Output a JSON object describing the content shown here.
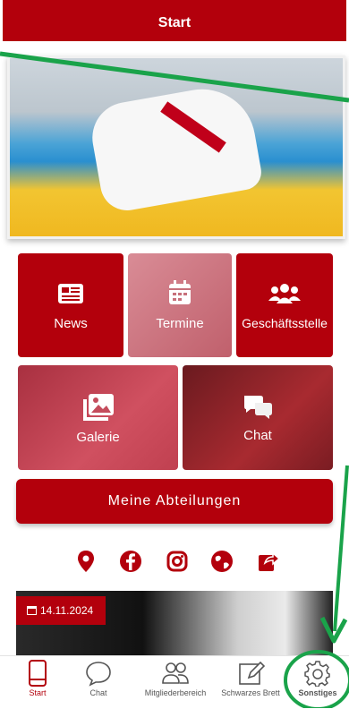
{
  "header": {
    "title": "Start"
  },
  "tiles": {
    "news": "News",
    "termine": "Termine",
    "geschaeftsstelle": "Geschäftsstelle",
    "galerie": "Galerie",
    "chat": "Chat"
  },
  "main_button": "Meine Abteilungen",
  "social_icons": [
    "location-pin-icon",
    "facebook-icon",
    "instagram-icon",
    "globe-icon",
    "share-icon"
  ],
  "news": {
    "date": "14.11.2024"
  },
  "tabbar": {
    "start": "Start",
    "chat": "Chat",
    "mitglieder": "Mitgliederbereich",
    "brett": "Schwarzes Brett",
    "sonstiges": "Sonstiges"
  },
  "colors": {
    "brand": "#b3000c",
    "annotation": "#1aa34a"
  }
}
